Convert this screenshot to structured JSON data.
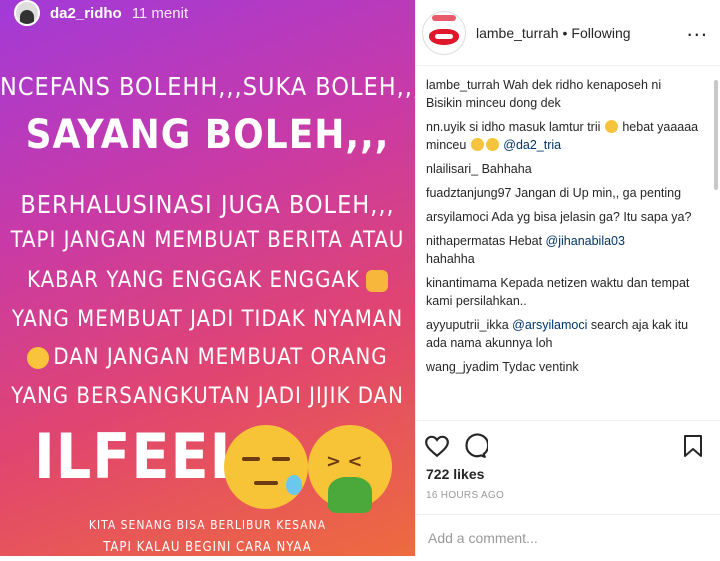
{
  "story": {
    "username": "da2_ridho",
    "time": "11 menit",
    "lines": [
      "NCEFANS BOLEHH,,,SUKA BOLEH,,,",
      "SAYANG BOLEH,,,",
      "BERHALUSINASI JUGA BOLEH,,,",
      "TAPI JANGAN MEMBUAT BERITA ATAU",
      "KABAR YANG ENGGAK ENGGAK",
      "YANG MEMBUAT JADI TIDAK NYAMAN",
      "DAN JANGAN  MEMBUAT ORANG",
      "YANG BERSANGKUTAN JADI JIJIK DAN",
      "ILFEEL",
      "KITA SENANG BISA BERLIBUR KESANA",
      "TAPI KALAU BEGINI CARA NYAA"
    ]
  },
  "header": {
    "username": "lambe_turrah",
    "separator": "•",
    "follow_status": "Following",
    "more": "..."
  },
  "comments": [
    {
      "user": "lambe_turrah",
      "text": "Wah dek ridho kenaposeh ni",
      "extra": "Bisikin minceu dong dek"
    },
    {
      "user": "nn.uyik",
      "text": "si idho masuk lamtur trii",
      "text2": "hebat yaaaaa minceu",
      "mention": "@da2_tria"
    },
    {
      "user": "nlailisari_",
      "text": "Bahhaha"
    },
    {
      "user": "fuadztanjung97",
      "text": "Jangan di Up min,, ga penting"
    },
    {
      "user": "arsyilamoci",
      "text": "Ada yg bisa jelasin ga? Itu sapa ya?"
    },
    {
      "user": "nithapermatas",
      "text": "Hebat",
      "mention": "@jihanabila03",
      "text2": "hahahha"
    },
    {
      "user": "kinantimama",
      "text": "Kepada netizen waktu dan tempat kami persilahkan.."
    },
    {
      "user": "ayyuputrii_ikka",
      "mention": "@arsyilamoci",
      "text": "search aja kak itu ada nama akunnya loh"
    },
    {
      "user": "wang_jyadim",
      "text": "Tydac ventink"
    }
  ],
  "likes": "722 likes",
  "timestamp": "16 HOURS AGO",
  "add_comment": {
    "placeholder": "Add a comment..."
  },
  "icons": {
    "like": "heart-icon",
    "comment": "comment-icon",
    "save": "bookmark-icon",
    "more": "more-options-icon"
  },
  "colors": {
    "gradient_start": "#a23ad8",
    "gradient_end": "#ee6b3e",
    "mention": "#003569",
    "brand_red": "#e0162b"
  }
}
